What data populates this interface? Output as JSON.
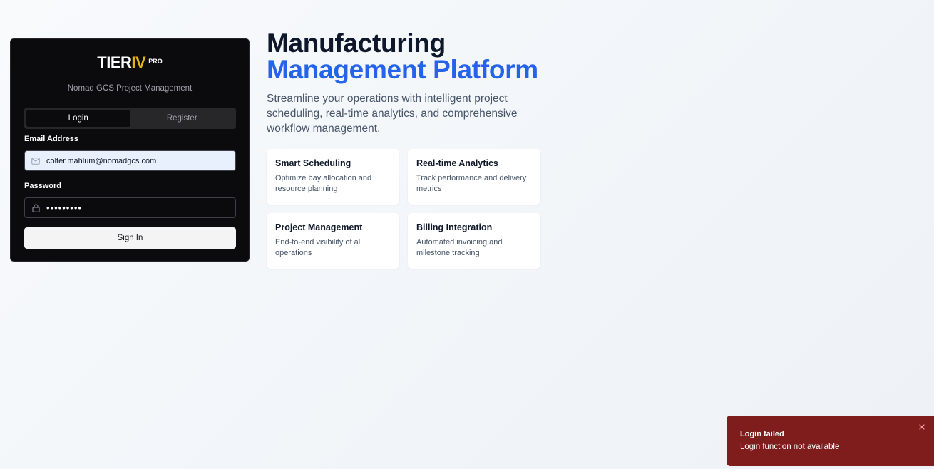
{
  "login": {
    "logo": {
      "tier": "TIER",
      "iv": "IV",
      "pro": "PRO"
    },
    "subtitle": "Nomad GCS Project Management",
    "tabs": [
      {
        "label": "Login",
        "active": true
      },
      {
        "label": "Register",
        "active": false
      }
    ],
    "email": {
      "label": "Email Address",
      "value": "colter.mahlum@nomadgcs.com",
      "icon": "mail-icon"
    },
    "password": {
      "label": "Password",
      "value": "•••••••••",
      "icon": "lock-icon"
    },
    "submit_label": "Sign In"
  },
  "hero": {
    "title_line1": "Manufacturing",
    "title_line2": "Management Platform",
    "description": "Streamline your operations with intelligent project scheduling, real-time analytics, and comprehensive workflow management.",
    "features": [
      {
        "title": "Smart Scheduling",
        "desc": "Optimize bay allocation and resource planning"
      },
      {
        "title": "Real-time Analytics",
        "desc": "Track performance and delivery metrics"
      },
      {
        "title": "Project Management",
        "desc": "End-to-end visibility of all operations"
      },
      {
        "title": "Billing Integration",
        "desc": "Automated invoicing and milestone tracking"
      }
    ]
  },
  "toast": {
    "title": "Login failed",
    "message": "Login function not available",
    "close_icon": "close-icon"
  },
  "colors": {
    "accent_blue": "#2563eb",
    "logo_gold": "#e4b21c",
    "card_dark": "#0b0b0d",
    "toast_red": "#7f1d1d"
  }
}
